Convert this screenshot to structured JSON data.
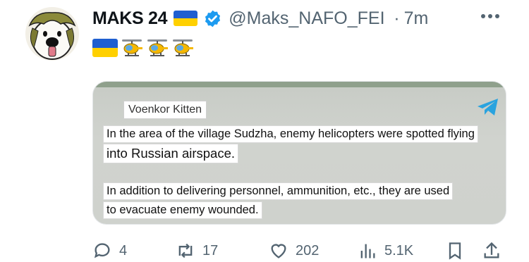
{
  "tweet": {
    "display_name": "MAKS 24",
    "handle": "@Maks_NAFO_FEI",
    "separator": "·",
    "time": "7m",
    "body_emojis": [
      "ukraine-flag",
      "helicopter",
      "helicopter",
      "helicopter"
    ],
    "avatar_icon": "cartoon-dog-avatar"
  },
  "card": {
    "channel_label": "Voenkor Kitten",
    "source_icon": "telegram-icon",
    "lines": [
      "In the area of the village Sudzha, enemy helicopters were spotted flying",
      "into Russian airspace.",
      "In addition to delivering personnel, ammunition, etc., they are used",
      "to evacuate enemy wounded."
    ]
  },
  "actions": {
    "replies": "4",
    "reposts": "17",
    "likes": "202",
    "views": "5.1K"
  },
  "colors": {
    "verified": "#1d9bf0",
    "muted_text": "#536471",
    "flag_blue": "#1f5fd0",
    "flag_yellow": "#ffd000",
    "telegram": "#2aa3df"
  }
}
